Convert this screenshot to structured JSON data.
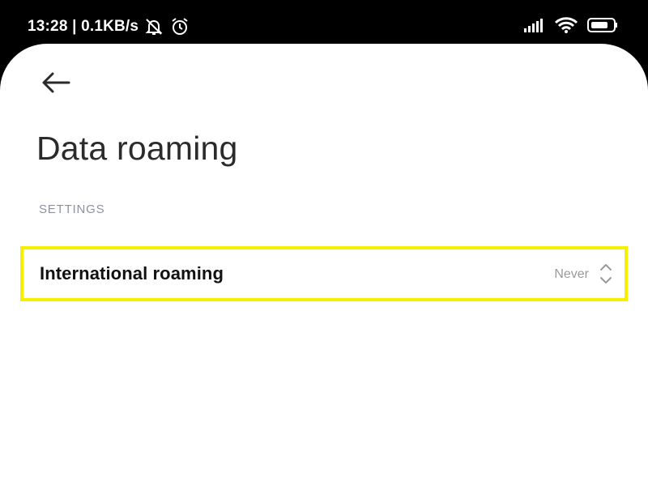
{
  "status_bar": {
    "time_speed": "13:28 | 0.1KB/s",
    "icons": [
      "bell-off-icon",
      "alarm-icon",
      "signal-icon",
      "wifi-icon",
      "battery-icon"
    ]
  },
  "header": {
    "back_icon": "arrow-left-icon",
    "title": "Data roaming"
  },
  "section": {
    "label": "SETTINGS"
  },
  "setting": {
    "label": "International roaming",
    "value": "Never",
    "icon": "chevron-updown-icon",
    "highlight_color": "#f7ef00"
  }
}
